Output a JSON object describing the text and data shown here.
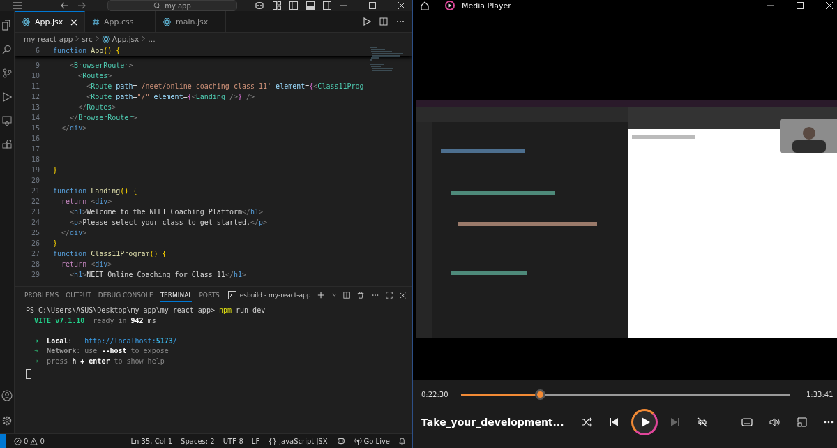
{
  "editor": {
    "titlebar": {
      "search": "my app"
    },
    "tabs": [
      {
        "label": "App.jsx",
        "kind": "react",
        "selected": true
      },
      {
        "label": "App.css",
        "kind": "css",
        "selected": false
      },
      {
        "label": "main.jsx",
        "kind": "react",
        "selected": false
      }
    ],
    "breadcrumb": [
      {
        "label": "my-react-app",
        "kind": "folder"
      },
      {
        "label": "src",
        "kind": "folder"
      },
      {
        "label": "App.jsx",
        "kind": "react"
      },
      {
        "label": "…",
        "kind": "more"
      }
    ],
    "sticky_line": {
      "number": "6",
      "tokens": [
        {
          "t": "function ",
          "kind": "kw"
        },
        {
          "t": "App",
          "kind": "fn"
        },
        {
          "t": "() {",
          "kind": "br"
        }
      ]
    },
    "lines": [
      {
        "number": "9",
        "tokens": [
          {
            "t": "    <",
            "kind": "punc"
          },
          {
            "t": "BrowserRouter",
            "kind": "tag"
          },
          {
            "t": ">",
            "kind": "punc"
          }
        ]
      },
      {
        "number": "10",
        "tokens": [
          {
            "t": "      <",
            "kind": "punc"
          },
          {
            "t": "Routes",
            "kind": "tag"
          },
          {
            "t": ">",
            "kind": "punc"
          }
        ]
      },
      {
        "number": "11",
        "tokens": [
          {
            "t": "        <",
            "kind": "punc"
          },
          {
            "t": "Route",
            "kind": "tag"
          },
          {
            "t": " path",
            "kind": "attr"
          },
          {
            "t": "=",
            "kind": "txt"
          },
          {
            "t": "'/neet/online-coaching-class-11'",
            "kind": "str"
          },
          {
            "t": " element",
            "kind": "attr"
          },
          {
            "t": "=",
            "kind": "txt"
          },
          {
            "t": "{",
            "kind": "br2"
          },
          {
            "t": "<",
            "kind": "punc"
          },
          {
            "t": "Class11Prog",
            "kind": "tag"
          }
        ]
      },
      {
        "number": "12",
        "tokens": [
          {
            "t": "        <",
            "kind": "punc"
          },
          {
            "t": "Route",
            "kind": "tag"
          },
          {
            "t": " path",
            "kind": "attr"
          },
          {
            "t": "=",
            "kind": "txt"
          },
          {
            "t": "\"/\"",
            "kind": "str"
          },
          {
            "t": " element",
            "kind": "attr"
          },
          {
            "t": "=",
            "kind": "txt"
          },
          {
            "t": "{",
            "kind": "br2"
          },
          {
            "t": "<",
            "kind": "punc"
          },
          {
            "t": "Landing",
            "kind": "tag"
          },
          {
            "t": " />",
            "kind": "punc"
          },
          {
            "t": "}",
            "kind": "br2"
          },
          {
            "t": " />",
            "kind": "punc"
          }
        ]
      },
      {
        "number": "13",
        "tokens": [
          {
            "t": "      </",
            "kind": "punc"
          },
          {
            "t": "Routes",
            "kind": "tag"
          },
          {
            "t": ">",
            "kind": "punc"
          }
        ]
      },
      {
        "number": "14",
        "tokens": [
          {
            "t": "    </",
            "kind": "punc"
          },
          {
            "t": "BrowserRouter",
            "kind": "tag"
          },
          {
            "t": ">",
            "kind": "punc"
          }
        ]
      },
      {
        "number": "15",
        "tokens": [
          {
            "t": "  </",
            "kind": "punc"
          },
          {
            "t": "div",
            "kind": "tag2"
          },
          {
            "t": ">",
            "kind": "punc"
          }
        ]
      },
      {
        "number": "16"
      },
      {
        "number": "17"
      },
      {
        "number": "18"
      },
      {
        "number": "19",
        "tokens": [
          {
            "t": "}",
            "kind": "br"
          }
        ]
      },
      {
        "number": "20"
      },
      {
        "number": "21",
        "tokens": [
          {
            "t": "function ",
            "kind": "kw"
          },
          {
            "t": "Landing",
            "kind": "fn"
          },
          {
            "t": "() {",
            "kind": "br"
          }
        ]
      },
      {
        "number": "22",
        "tokens": [
          {
            "t": "  return ",
            "kind": "ctl"
          },
          {
            "t": "<",
            "kind": "punc"
          },
          {
            "t": "div",
            "kind": "tag2"
          },
          {
            "t": ">",
            "kind": "punc"
          }
        ]
      },
      {
        "number": "23",
        "tokens": [
          {
            "t": "    <",
            "kind": "punc"
          },
          {
            "t": "h1",
            "kind": "tag2"
          },
          {
            "t": ">",
            "kind": "punc"
          },
          {
            "t": "Welcome to the NEET Coaching Platform",
            "kind": "txt"
          },
          {
            "t": "</",
            "kind": "punc"
          },
          {
            "t": "h1",
            "kind": "tag2"
          },
          {
            "t": ">",
            "kind": "punc"
          }
        ]
      },
      {
        "number": "24",
        "tokens": [
          {
            "t": "    <",
            "kind": "punc"
          },
          {
            "t": "p",
            "kind": "tag2"
          },
          {
            "t": ">",
            "kind": "punc"
          },
          {
            "t": "Please select your class to get started.",
            "kind": "txt"
          },
          {
            "t": "</",
            "kind": "punc"
          },
          {
            "t": "p",
            "kind": "tag2"
          },
          {
            "t": ">",
            "kind": "punc"
          }
        ]
      },
      {
        "number": "25",
        "tokens": [
          {
            "t": "  </",
            "kind": "punc"
          },
          {
            "t": "div",
            "kind": "tag2"
          },
          {
            "t": ">",
            "kind": "punc"
          }
        ]
      },
      {
        "number": "26",
        "tokens": [
          {
            "t": "}",
            "kind": "br"
          }
        ]
      },
      {
        "number": "27",
        "tokens": [
          {
            "t": "function ",
            "kind": "kw"
          },
          {
            "t": "Class11Program",
            "kind": "fn"
          },
          {
            "t": "() {",
            "kind": "br"
          }
        ]
      },
      {
        "number": "28",
        "tokens": [
          {
            "t": "  return ",
            "kind": "ctl"
          },
          {
            "t": "<",
            "kind": "punc"
          },
          {
            "t": "div",
            "kind": "tag2"
          },
          {
            "t": ">",
            "kind": "punc"
          }
        ]
      },
      {
        "number": "29",
        "tokens": [
          {
            "t": "    <",
            "kind": "punc"
          },
          {
            "t": "h1",
            "kind": "tag2"
          },
          {
            "t": ">",
            "kind": "punc"
          },
          {
            "t": "NEET Online Coaching for Class 11",
            "kind": "txt"
          },
          {
            "t": "</",
            "kind": "punc"
          },
          {
            "t": "h1",
            "kind": "tag2"
          },
          {
            "t": ">",
            "kind": "punc"
          }
        ]
      }
    ],
    "panel_tabs": [
      {
        "label": "PROBLEMS",
        "selected": false
      },
      {
        "label": "OUTPUT",
        "selected": false
      },
      {
        "label": "DEBUG CONSOLE",
        "selected": false
      },
      {
        "label": "TERMINAL",
        "selected": true
      },
      {
        "label": "PORTS",
        "selected": false
      }
    ],
    "terminal_name": "esbuild - my-react-app",
    "terminal": [
      {
        "tokens": [
          {
            "t": "PS C:\\Users\\ASUS\\Desktop\\my app\\my-react-app> ",
            "kind": "plain"
          },
          {
            "t": "npm",
            "kind": "cmd"
          },
          {
            "t": " run dev",
            "kind": "plain"
          }
        ]
      },
      {
        "tokens": [
          {
            "t": "  VITE v7.1.10",
            "kind": "green"
          },
          {
            "t": "  ready in ",
            "kind": "dim"
          },
          {
            "t": "942",
            "kind": "bold"
          },
          {
            "t": " ms",
            "kind": "plain"
          }
        ]
      },
      {
        "blank_before": true,
        "tokens": [
          {
            "t": "  ➜  ",
            "kind": "green"
          },
          {
            "t": "Local",
            "kind": "bold"
          },
          {
            "t": ":   ",
            "kind": "plain"
          },
          {
            "t": "http://localhost:",
            "kind": "link"
          },
          {
            "t": "5173",
            "kind": "linkb"
          },
          {
            "t": "/",
            "kind": "link"
          }
        ]
      },
      {
        "tokens": [
          {
            "t": "  ➜  ",
            "kind": "dimgreen"
          },
          {
            "t": "Network",
            "kind": "dimbold"
          },
          {
            "t": ": use ",
            "kind": "dim"
          },
          {
            "t": "--host",
            "kind": "bold"
          },
          {
            "t": " to expose",
            "kind": "dim"
          }
        ]
      },
      {
        "tokens": [
          {
            "t": "  ➜  ",
            "kind": "dimgreen"
          },
          {
            "t": "press ",
            "kind": "dim"
          },
          {
            "t": "h + enter",
            "kind": "bold"
          },
          {
            "t": " to show help",
            "kind": "dim"
          }
        ]
      }
    ],
    "status_bar": {
      "errors": "0",
      "warnings": "0",
      "items": [
        "Ln 35, Col 1",
        "Spaces: 2",
        "UTF-8",
        "LF"
      ],
      "language_icon": "{}",
      "language": "JavaScript JSX",
      "go_live": "Go Live"
    }
  },
  "player": {
    "title": "Media Player",
    "elapsed": "0:22:30",
    "duration": "1:33:41",
    "level": 0.24,
    "video_title": "Take_your_development...",
    "playing": false,
    "next_disabled": true
  }
}
